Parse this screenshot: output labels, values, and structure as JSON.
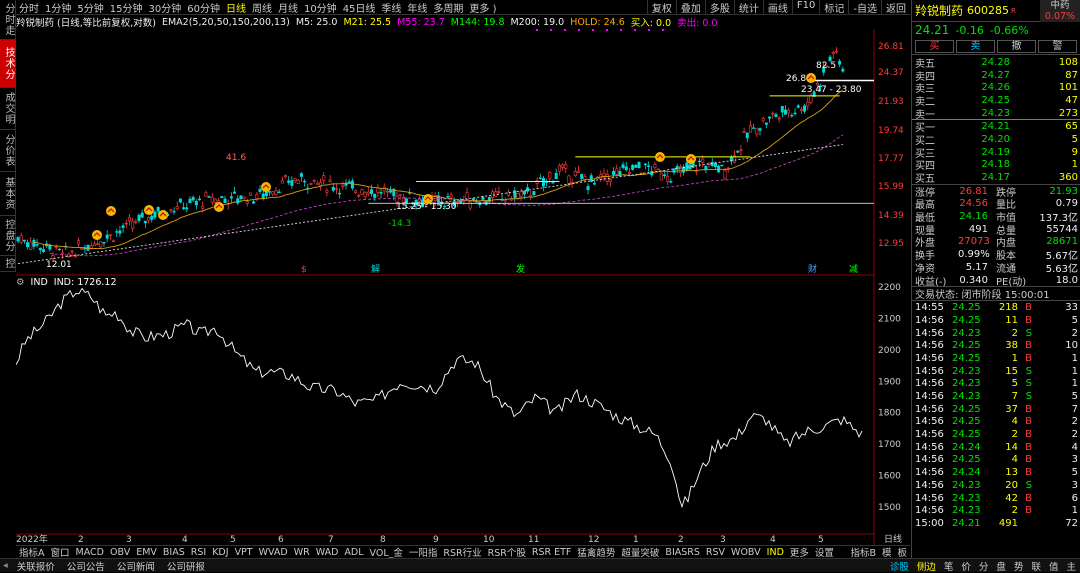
{
  "left_tabs": [
    "分时走势",
    "技术分析",
    "成交明细",
    "分价表",
    "基本资料",
    "控盘分析",
    "控盘基本"
  ],
  "left_tab_active": 1,
  "periods": [
    "分时",
    "1分钟",
    "5分钟",
    "15分钟",
    "30分钟",
    "60分钟",
    "日线",
    "周线",
    "月线",
    "10分钟",
    "45日线",
    "季线",
    "年线",
    "多周期",
    "更多 )"
  ],
  "period_active": 6,
  "tool_buttons": [
    "复权",
    "叠加",
    "多股",
    "统计",
    "画线",
    "F10",
    "标记",
    "-自选",
    "返回"
  ],
  "info": {
    "stock_title": "羚锐制药 (日线,等比前复权,对数)",
    "ema_name": "EMA2(5,20,50,150,200,13)",
    "m5": "M5: 25.0",
    "m21": "M21: 25.5",
    "m55": "M55: 23.7",
    "m144": "M144: 19.8",
    "m200": "M200: 19.0",
    "hold": "HOLD: 24.6",
    "buy": "买入: 0.0",
    "sell": "卖出: 0.0"
  },
  "price_axis": [
    "26.81",
    "24.37",
    "21.93",
    "19.74",
    "17.77",
    "15.99",
    "14.39",
    "12.95"
  ],
  "price_annotations": [
    "82.5",
    "26.89",
    "23.47 - 23.80",
    "41.6",
    "15.25 - 15.30",
    "-14.3",
    "12.01"
  ],
  "event_markers": [
    "$",
    "解",
    "发",
    "财",
    "减"
  ],
  "indicator": {
    "label": "IND",
    "value": "IND: 1726.12",
    "axis": [
      "2200",
      "2100",
      "2000",
      "1900",
      "1800",
      "1700",
      "1600",
      "1500"
    ]
  },
  "x_axis_months": [
    "2022年",
    "2",
    "3",
    "4",
    "5",
    "6",
    "7",
    "8",
    "9",
    "10",
    "11",
    "12",
    "1",
    "2",
    "3",
    "4",
    "5",
    "日线"
  ],
  "indicator_tabs": [
    "指标A",
    "窗口",
    "MACD",
    "OBV",
    "EMV",
    "BIAS",
    "RSI",
    "KDJ",
    "VPT",
    "WVAD",
    "WR",
    "WAD",
    "ADL",
    "VOL_金",
    "一阳指",
    "RSR行业",
    "RSR个股",
    "RSR ETF",
    "猛禽趋势",
    "超量突破",
    "BIASRS",
    "RSV",
    "WOBV",
    "IND",
    "更多",
    "设置"
  ],
  "indicator_tab_active": 23,
  "bottom_right": [
    "指标B",
    "模",
    "板"
  ],
  "status_links": [
    "关联报价",
    "公司公告",
    "公司新闻",
    "公司研报"
  ],
  "status_right": [
    "诊股",
    "侧边",
    "笔",
    "价",
    "分",
    "盘",
    "势",
    "联",
    "值",
    "主"
  ],
  "quote": {
    "name": "羚锐制药",
    "code": "600285",
    "badge": "R",
    "sector": "中药",
    "sector_pct": "0.07%",
    "price": "24.21",
    "change": "-0.16",
    "pct": "-0.66%",
    "actions": [
      "买",
      "卖",
      "撤",
      "警"
    ],
    "asks": [
      {
        "label": "卖五",
        "price": "24.28",
        "vol": "108"
      },
      {
        "label": "卖四",
        "price": "24.27",
        "vol": "87"
      },
      {
        "label": "卖三",
        "price": "24.26",
        "vol": "101"
      },
      {
        "label": "卖二",
        "price": "24.25",
        "vol": "47"
      },
      {
        "label": "卖一",
        "price": "24.23",
        "vol": "273"
      }
    ],
    "bids": [
      {
        "label": "买一",
        "price": "24.21",
        "vol": "65"
      },
      {
        "label": "买二",
        "price": "24.20",
        "vol": "5"
      },
      {
        "label": "买三",
        "price": "24.19",
        "vol": "9"
      },
      {
        "label": "买四",
        "price": "24.18",
        "vol": "1"
      },
      {
        "label": "买五",
        "price": "24.17",
        "vol": "360"
      }
    ],
    "stats": [
      [
        "涨停",
        "26.81",
        "跌停",
        "21.93"
      ],
      [
        "最高",
        "24.56",
        "量比",
        "0.79"
      ],
      [
        "最低",
        "24.16",
        "市值",
        "137.3亿"
      ],
      [
        "现量",
        "491",
        "总量",
        "55744"
      ],
      [
        "外盘",
        "27073",
        "内盘",
        "28671"
      ],
      [
        "换手",
        "0.99%",
        "股本",
        "5.67亿"
      ],
      [
        "净资",
        "5.17",
        "流通",
        "5.63亿"
      ],
      [
        "收益(-)",
        "0.340",
        "PE(动)",
        "18.0"
      ]
    ],
    "trade_state": "交易状态: 闭市阶段 15:00:01",
    "ticks": [
      [
        "14:55",
        "24.25",
        "218",
        "B",
        "33"
      ],
      [
        "14:56",
        "24.25",
        "11",
        "B",
        "5"
      ],
      [
        "14:56",
        "24.23",
        "2",
        "S",
        "2"
      ],
      [
        "14:56",
        "24.25",
        "38",
        "B",
        "10"
      ],
      [
        "14:56",
        "24.25",
        "1",
        "B",
        "1"
      ],
      [
        "14:56",
        "24.23",
        "15",
        "S",
        "1"
      ],
      [
        "14:56",
        "24.23",
        "5",
        "S",
        "1"
      ],
      [
        "14:56",
        "24.23",
        "7",
        "S",
        "5"
      ],
      [
        "14:56",
        "24.25",
        "37",
        "B",
        "7"
      ],
      [
        "14:56",
        "24.25",
        "4",
        "B",
        "2"
      ],
      [
        "14:56",
        "24.25",
        "2",
        "B",
        "2"
      ],
      [
        "14:56",
        "24.24",
        "14",
        "B",
        "4"
      ],
      [
        "14:56",
        "24.25",
        "4",
        "B",
        "3"
      ],
      [
        "14:56",
        "24.24",
        "13",
        "B",
        "5"
      ],
      [
        "14:56",
        "24.23",
        "20",
        "S",
        "3"
      ],
      [
        "14:56",
        "24.23",
        "42",
        "B",
        "6"
      ],
      [
        "14:56",
        "24.23",
        "2",
        "B",
        "1"
      ],
      [
        "15:00",
        "24.21",
        "491",
        "",
        "72"
      ]
    ]
  }
}
